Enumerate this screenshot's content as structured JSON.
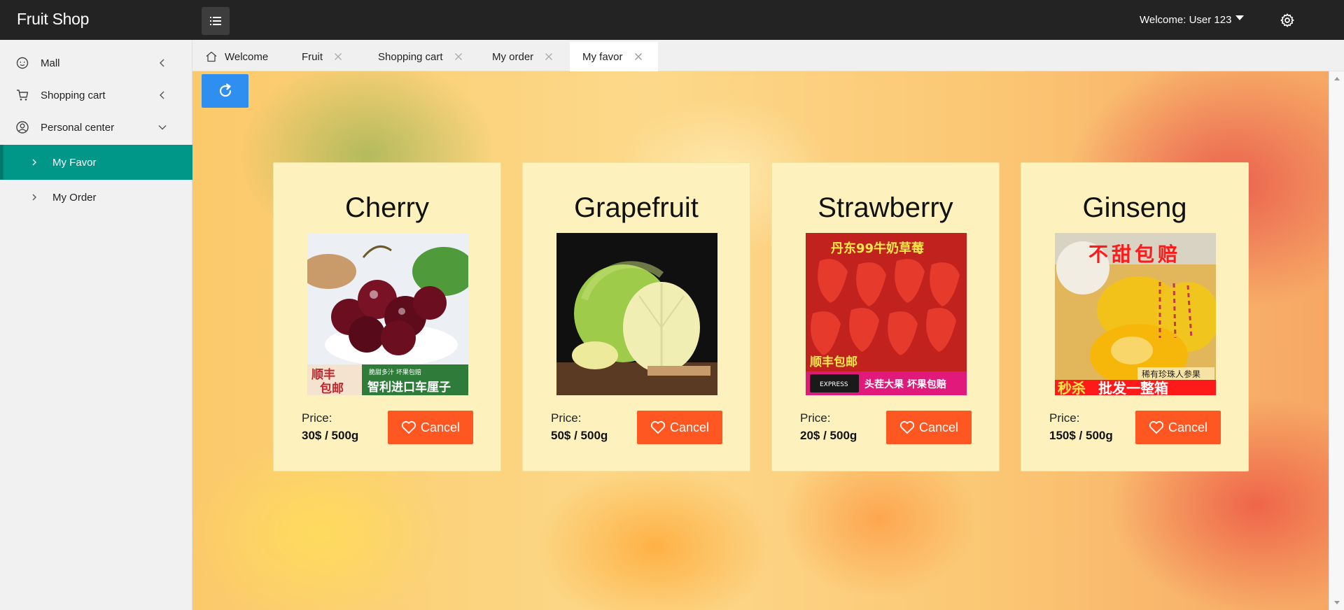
{
  "header": {
    "brand": "Fruit Shop",
    "welcome": "Welcome: User 123"
  },
  "sidebar": {
    "items": [
      {
        "label": "Mall",
        "icon": "smile-icon"
      },
      {
        "label": "Shopping cart",
        "icon": "cart-icon"
      },
      {
        "label": "Personal center",
        "icon": "user-circle-icon"
      }
    ],
    "sub_items": [
      {
        "label": "My Favor",
        "active": true
      },
      {
        "label": "My Order",
        "active": false
      }
    ]
  },
  "tabs": [
    {
      "label": "Welcome",
      "closable": false
    },
    {
      "label": "Fruit",
      "closable": true
    },
    {
      "label": "Shopping cart",
      "closable": true
    },
    {
      "label": "My order",
      "closable": true
    },
    {
      "label": "My favor",
      "closable": true,
      "active": true
    }
  ],
  "products": [
    {
      "name": "Cherry",
      "price_label": "Price:",
      "price": "30$ / 500g",
      "button": "Cancel",
      "image_text": [
        "顺丰",
        "包邮",
        "脆甜多汁 坏果包赔",
        "智利进口车厘子"
      ]
    },
    {
      "name": "Grapefruit",
      "price_label": "Price:",
      "price": "50$ / 500g",
      "button": "Cancel",
      "image_text": []
    },
    {
      "name": "Strawberry",
      "price_label": "Price:",
      "price": "20$ / 500g",
      "button": "Cancel",
      "image_text": [
        "丹东99牛奶草莓",
        "顺丰包邮",
        "EXPRESS",
        "头茬大果 坏果包赔"
      ]
    },
    {
      "name": "Ginseng",
      "price_label": "Price:",
      "price": "150$ / 500g",
      "button": "Cancel",
      "image_text": [
        "不甜包赔",
        "稀有珍珠人参果",
        "秒杀",
        "批发一整箱"
      ]
    }
  ],
  "colors": {
    "header_bg": "#232323",
    "active_menu": "#009688",
    "refresh_button": "#2f8ff0",
    "cancel_button": "#ff5722",
    "card_bg": "#fdf2bd"
  }
}
